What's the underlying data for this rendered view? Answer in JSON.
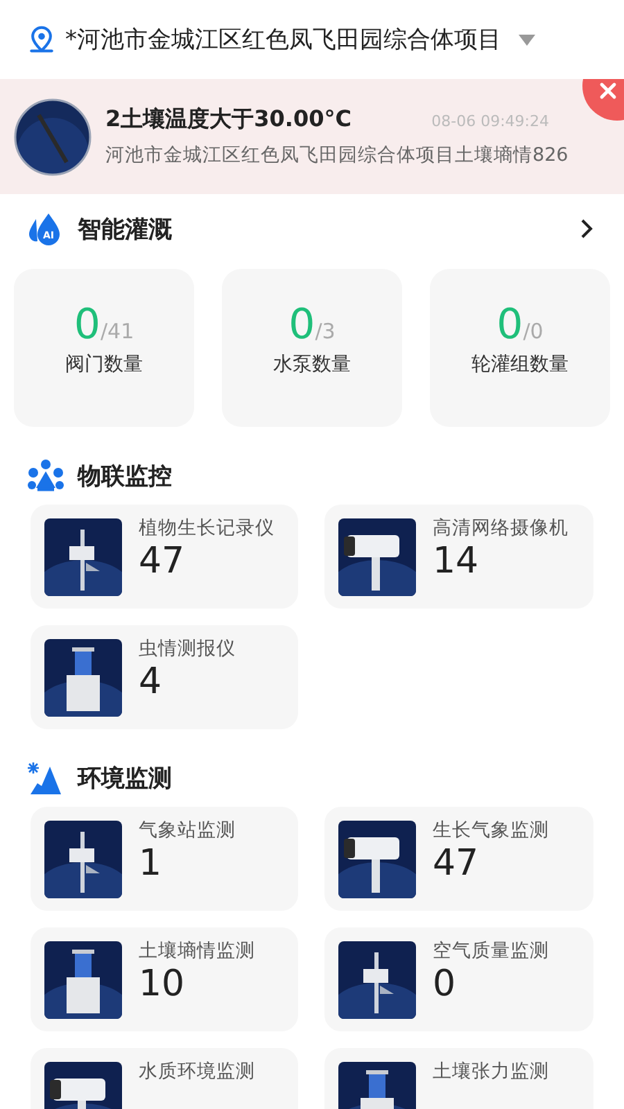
{
  "header": {
    "project": "*河池市金城江区红色凤飞田园综合体项目"
  },
  "alert": {
    "title": "2土壤温度大于30.00°C",
    "time": "08-06 09:49:24",
    "detail": "河池市金城江区红色凤飞田园综合体项目土壤墒情826"
  },
  "irrigation": {
    "title": "智能灌溉",
    "icon_text": "AI",
    "stats": [
      {
        "value": "0",
        "total": "/41",
        "label": "阀门数量"
      },
      {
        "value": "0",
        "total": "/3",
        "label": "水泵数量"
      },
      {
        "value": "0",
        "total": "/0",
        "label": "轮灌组数量"
      }
    ]
  },
  "sections": [
    {
      "title": "物联监控",
      "devices": [
        {
          "name": "植物生长记录仪",
          "count": "47"
        },
        {
          "name": "高清网络摄像机",
          "count": "14"
        },
        {
          "name": "虫情测报仪",
          "count": "4"
        }
      ]
    },
    {
      "title": "环境监测",
      "devices": [
        {
          "name": "气象站监测",
          "count": "1"
        },
        {
          "name": "生长气象监测",
          "count": "47"
        },
        {
          "name": "土壤墒情监测",
          "count": "10"
        },
        {
          "name": "空气质量监测",
          "count": "0"
        },
        {
          "name": "水质环境监测"
        },
        {
          "name": "土壤张力监测"
        }
      ]
    }
  ]
}
